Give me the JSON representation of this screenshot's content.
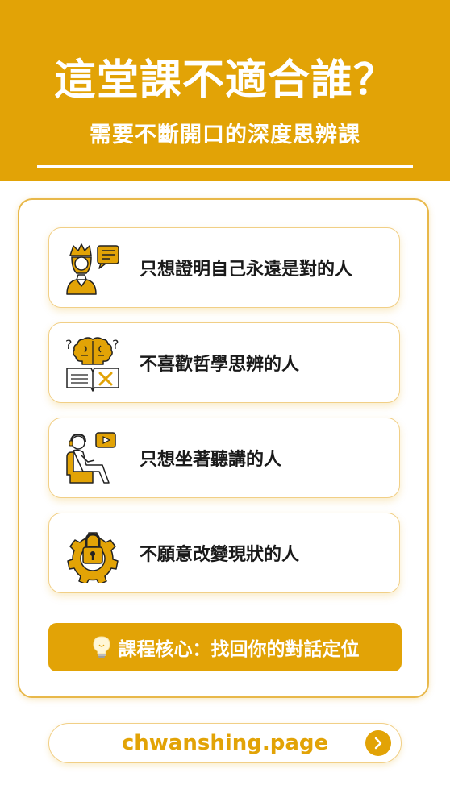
{
  "header": {
    "title": "這堂課不適合誰？",
    "subtitle": "需要不斷開口的深度思辨課"
  },
  "items": [
    {
      "label": "只想證明自己永遠是對的人",
      "icon": "queen-speech-icon"
    },
    {
      "label": "不喜歡哲學思辨的人",
      "icon": "brain-book-icon"
    },
    {
      "label": "只想坐著聽講的人",
      "icon": "person-armchair-video-icon"
    },
    {
      "label": "不願意改變現狀的人",
      "icon": "gear-lock-icon"
    }
  ],
  "banner": {
    "text": "課程核心：找回你的對話定位",
    "icon": "lightbulb-icon"
  },
  "link": {
    "url": "chwanshing.page",
    "icon": "chevron-right-icon"
  },
  "colors": {
    "accent": "#e2a306",
    "text": "#1a1a1a",
    "icon_dark": "#222222"
  }
}
